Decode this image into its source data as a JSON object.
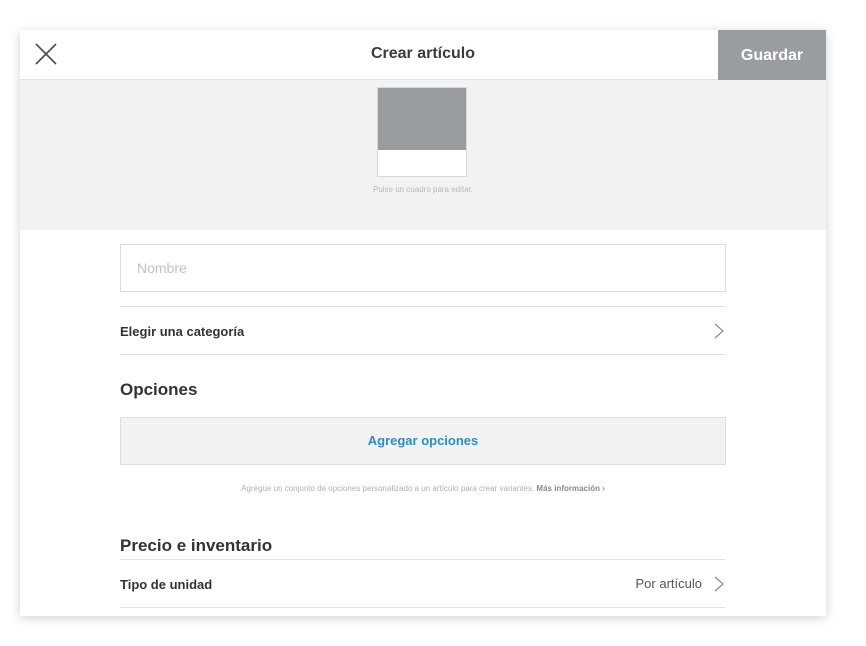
{
  "header": {
    "title": "Crear artículo",
    "close_icon": "close-icon",
    "save_label": "Guardar"
  },
  "image": {
    "hint": "Pulse un cuadro para editar."
  },
  "form": {
    "name_placeholder": "Nombre",
    "name_value": "",
    "category_label": "Elegir una categoría"
  },
  "options": {
    "title": "Opciones",
    "add_label": "Agregar opciones",
    "hint": "Agregue un conjunto de opciones personalizado a un artículo para crear variantes.",
    "more_info": "Más información ›"
  },
  "pricing": {
    "title": "Precio e inventario",
    "unit_label": "Tipo de unidad",
    "unit_value": "Por artículo"
  },
  "colors": {
    "accent": "#2a8fc7",
    "save_bg": "#9a9d9f",
    "tile_bg": "#999c9f"
  }
}
